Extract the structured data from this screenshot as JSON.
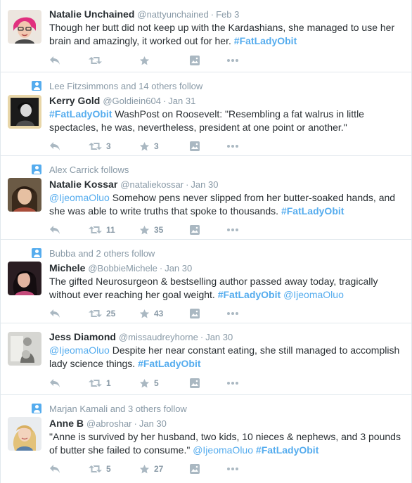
{
  "colors": {
    "link": "#55acee",
    "muted": "#8899a6",
    "icon": "#aab8c2",
    "border": "#e1e8ed",
    "text": "#292f33"
  },
  "tweets": [
    {
      "context": "",
      "fullname": "Natalie Unchained",
      "username": "@nattyunchained",
      "time": "Feb 3",
      "body": [
        {
          "t": "Though her butt did not keep up with the Kardashians, she managed to use her brain and amazingly, it worked out for her.  "
        },
        {
          "t": "#FatLadyObit",
          "k": "hashtag"
        }
      ],
      "retweets": "",
      "favorites": ""
    },
    {
      "context": "Lee Fitzsimmons and 14 others follow",
      "fullname": "Kerry Gold",
      "username": "@Goldiein604",
      "time": "Jan 31",
      "body": [
        {
          "t": "#FatLadyObit",
          "k": "hashtag"
        },
        {
          "t": " WashPost on Roosevelt: \"Resembling a fat walrus in little spectacles, he was, nevertheless, president at one point or another.\""
        }
      ],
      "retweets": "3",
      "favorites": "3"
    },
    {
      "context": "Alex Carrick follows",
      "fullname": "Natalie Kossar",
      "username": "@nataliekossar",
      "time": "Jan 30",
      "body": [
        {
          "t": "@IjeomaOluo",
          "k": "link"
        },
        {
          "t": " Somehow pens never slipped from her butter-soaked hands, and she was able to write truths that spoke to thousands. "
        },
        {
          "t": "#FatLadyObit",
          "k": "hashtag"
        }
      ],
      "retweets": "11",
      "favorites": "35"
    },
    {
      "context": "Bubba and 2 others follow",
      "fullname": "Michele",
      "username": "@BobbieMichele",
      "time": "Jan 30",
      "body": [
        {
          "t": "The gifted Neurosurgeon & bestselling author passed away today, tragically without ever reaching her goal weight. "
        },
        {
          "t": "#FatLadyObit",
          "k": "hashtag"
        },
        {
          "t": " "
        },
        {
          "t": "@IjeomaOluo",
          "k": "link"
        }
      ],
      "retweets": "25",
      "favorites": "43"
    },
    {
      "context": "",
      "fullname": "Jess Diamond",
      "username": "@missaudreyhorne",
      "time": "Jan 30",
      "body": [
        {
          "t": "@IjeomaOluo",
          "k": "link"
        },
        {
          "t": " Despite her near constant eating, she still managed to accomplish lady science things. "
        },
        {
          "t": "#FatLadyObit",
          "k": "hashtag"
        }
      ],
      "retweets": "1",
      "favorites": "5"
    },
    {
      "context": "Marjan Kamali and 3 others follow",
      "fullname": "Anne B",
      "username": "@abroshar",
      "time": "Jan 30",
      "body": [
        {
          "t": "\"Anne is survived by her husband, two kids, 10 nieces & nephews, and 3 pounds of butter she failed to consume.\" "
        },
        {
          "t": "@IjeomaOluo",
          "k": "link"
        },
        {
          "t": " "
        },
        {
          "t": "#FatLadyObit",
          "k": "hashtag"
        }
      ],
      "retweets": "5",
      "favorites": "27"
    }
  ]
}
